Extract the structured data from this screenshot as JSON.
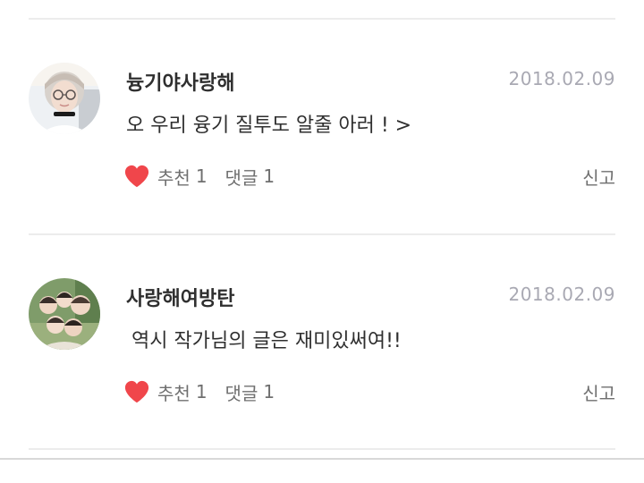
{
  "comments": [
    {
      "username": "늉기야사랑해",
      "date": "2018.02.09",
      "text": "오 우리 융기 질투도 알줄 아러 ! >",
      "like_label": "추천",
      "like_count": "1",
      "reply_label": "댓글",
      "reply_count": "1",
      "report_label": "신고"
    },
    {
      "username": "사랑해여방탄",
      "date": "2018.02.09",
      "text": "역시 작가님의 글은 재미있써여!!",
      "like_label": "추천",
      "like_count": "1",
      "reply_label": "댓글",
      "reply_count": "1",
      "report_label": "신고"
    }
  ],
  "colors": {
    "heart": "#f0464b",
    "username": "#2f2f2f",
    "date": "#a9a9b3",
    "meta": "#6f6f6f",
    "divider": "#ececec"
  },
  "icons": {
    "like": "heart-icon"
  }
}
